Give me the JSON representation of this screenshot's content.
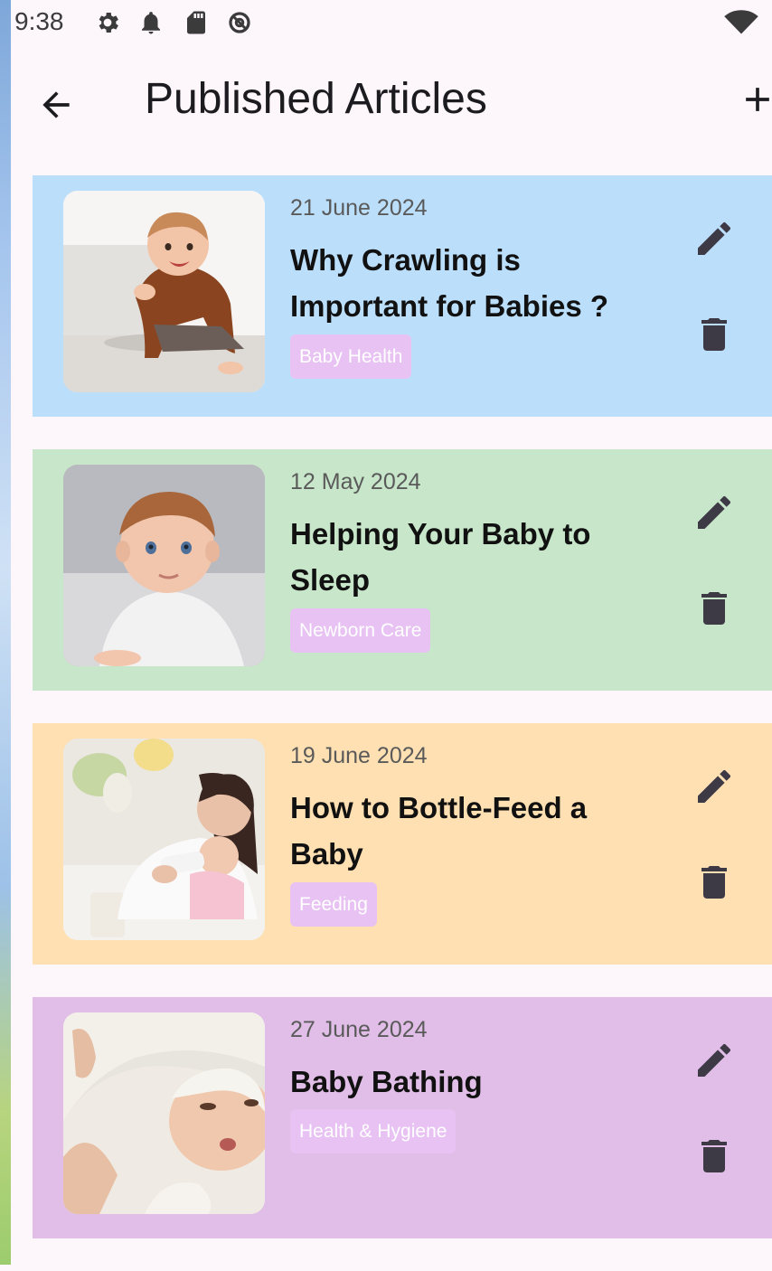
{
  "status_bar": {
    "time": "9:38",
    "icons": [
      "gear-icon",
      "bell-icon",
      "sd-card-icon",
      "sync-disabled-icon",
      "wifi-icon"
    ]
  },
  "app_bar": {
    "title": "Published Articles",
    "back_icon": "arrow-back-icon",
    "add_icon": "add-icon"
  },
  "colors": {
    "card_1": "#bbdefb",
    "card_2": "#c8e6c9",
    "card_3": "#ffe0b2",
    "card_4": "#e1bee7",
    "tag_background": "#e7c2f3",
    "icon": "#3d3a46"
  },
  "articles": [
    {
      "date": "21 June 2024",
      "title": "Why Crawling is Important for Babies ?",
      "category": "Baby Health",
      "image": "baby-crawling-photo"
    },
    {
      "date": "12 May 2024",
      "title": "Helping Your Baby to Sleep",
      "category": "Newborn Care",
      "image": "baby-sitting-photo"
    },
    {
      "date": "19 June 2024",
      "title": "How to Bottle-Feed a Baby",
      "category": "Feeding",
      "image": "mother-bottle-feeding-photo"
    },
    {
      "date": "27 June 2024",
      "title": "Baby Bathing",
      "category": "Health & Hygiene",
      "image": "baby-in-towel-photo"
    }
  ]
}
